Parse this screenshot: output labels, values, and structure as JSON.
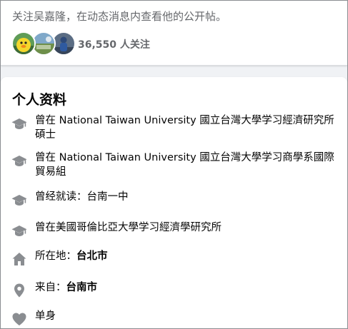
{
  "follow": {
    "message": "关注吴嘉隆，在动态消息内查看他的公开帖。",
    "followers_text": "36,550 人关注"
  },
  "profile": {
    "title": "个人资料",
    "items": [
      {
        "icon": "graduation-cap-icon",
        "text": "曾在 National Taiwan University 國立台灣大學学习經濟研究所碩士"
      },
      {
        "icon": "graduation-cap-icon",
        "text": "曾在 National Taiwan University 國立台灣大學学习商學系國際貿易組"
      },
      {
        "icon": "graduation-cap-icon",
        "prefix": "曾经就读：",
        "text": "台南一中"
      },
      {
        "icon": "graduation-cap-icon",
        "text": "曾在美國哥倫比亞大學学习經濟學研究所"
      },
      {
        "icon": "home-icon",
        "prefix": "所在地：",
        "value": "台北市"
      },
      {
        "icon": "location-pin-icon",
        "prefix": "来自：",
        "value": "台南市"
      },
      {
        "icon": "heart-icon",
        "text": "单身"
      }
    ]
  },
  "colors": {
    "icon_gray": "#8a8d91",
    "secondary_text": "#65676b",
    "page_bg": "#f0f2f5"
  }
}
